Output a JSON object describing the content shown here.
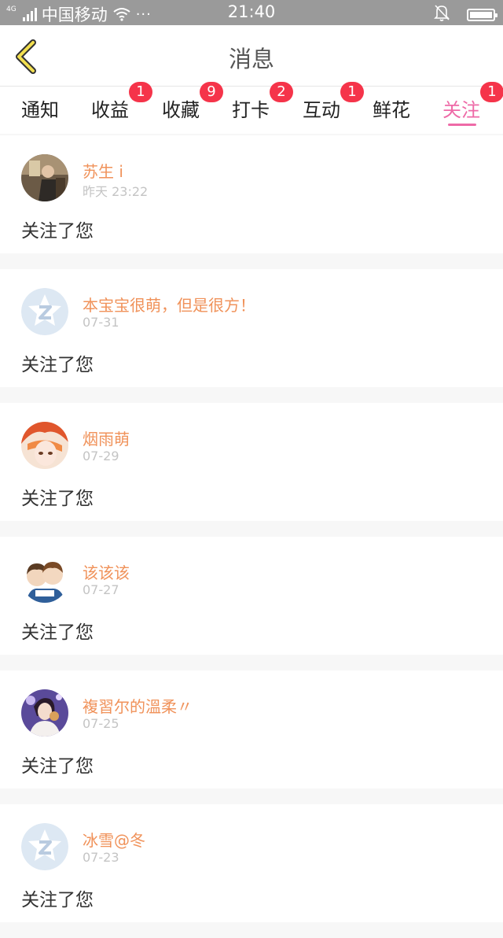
{
  "status_bar": {
    "network_type": "4G",
    "carrier": "中国移动",
    "more": "···",
    "time": "21:40"
  },
  "header": {
    "title": "消息"
  },
  "tabs": [
    {
      "label": "通知",
      "badge": ""
    },
    {
      "label": "收益",
      "badge": "1"
    },
    {
      "label": "收藏",
      "badge": "9"
    },
    {
      "label": "打卡",
      "badge": "2"
    },
    {
      "label": "互动",
      "badge": "1"
    },
    {
      "label": "鲜花",
      "badge": ""
    },
    {
      "label": "关注",
      "badge": "1",
      "active": true
    }
  ],
  "notifications": [
    {
      "user": "苏生 i",
      "time": "昨天 23:22",
      "message": "关注了您",
      "avatar": "photo"
    },
    {
      "user": "本宝宝很萌，但是很方！",
      "time": "07-31",
      "message": "关注了您",
      "avatar": "qq-default-icon"
    },
    {
      "user": "烟雨萌",
      "time": "07-29",
      "message": "关注了您",
      "avatar": "anime"
    },
    {
      "user": "该该该",
      "time": "07-27",
      "message": "关注了您",
      "avatar": "cartoon-couple"
    },
    {
      "user": "複習尔的溫柔〃",
      "time": "07-25",
      "message": "关注了您",
      "avatar": "photo"
    },
    {
      "user": "冰雪@冬",
      "time": "07-23",
      "message": "关注了您",
      "avatar": "qq-default-icon"
    }
  ],
  "colors": {
    "accent_pink": "#ee6aa7",
    "badge_red": "#f5344a",
    "username_orange": "#f0925a",
    "status_bar_gray": "#9a9a9a"
  }
}
